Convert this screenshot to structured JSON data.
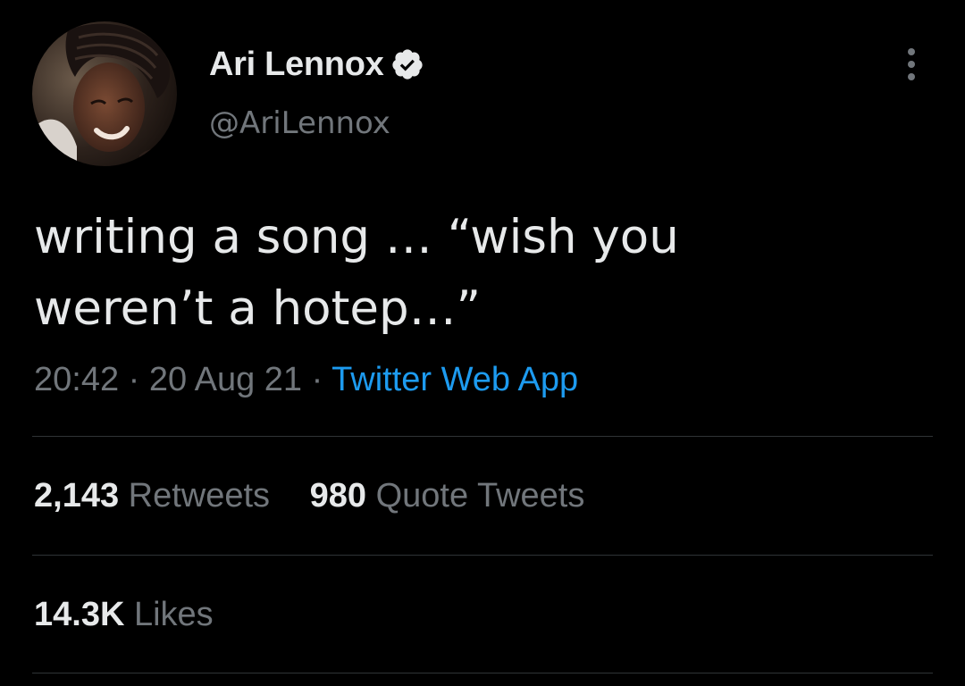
{
  "tweet": {
    "author": {
      "display_name": "Ari Lennox",
      "handle": "@AriLennox",
      "verified": true
    },
    "text": "writing a song … “wish you\nweren’t a hotep…”",
    "time": "20:42",
    "separator": "·",
    "date": "20 Aug 21",
    "source": "Twitter Web App",
    "stats": {
      "retweets": {
        "count": "2,143",
        "label": "Retweets"
      },
      "quote_tweets": {
        "count": "980",
        "label": "Quote Tweets"
      },
      "likes": {
        "count": "14.3K",
        "label": "Likes"
      }
    }
  },
  "colors": {
    "background": "#000000",
    "primary_text": "#e7e9ea",
    "secondary_text": "#71767b",
    "link": "#1d9bf0",
    "verified_badge": "#e7e9ea",
    "divider": "#2f3336"
  },
  "icons": {
    "verified": "verified-badge-icon",
    "more": "more-options-icon"
  }
}
